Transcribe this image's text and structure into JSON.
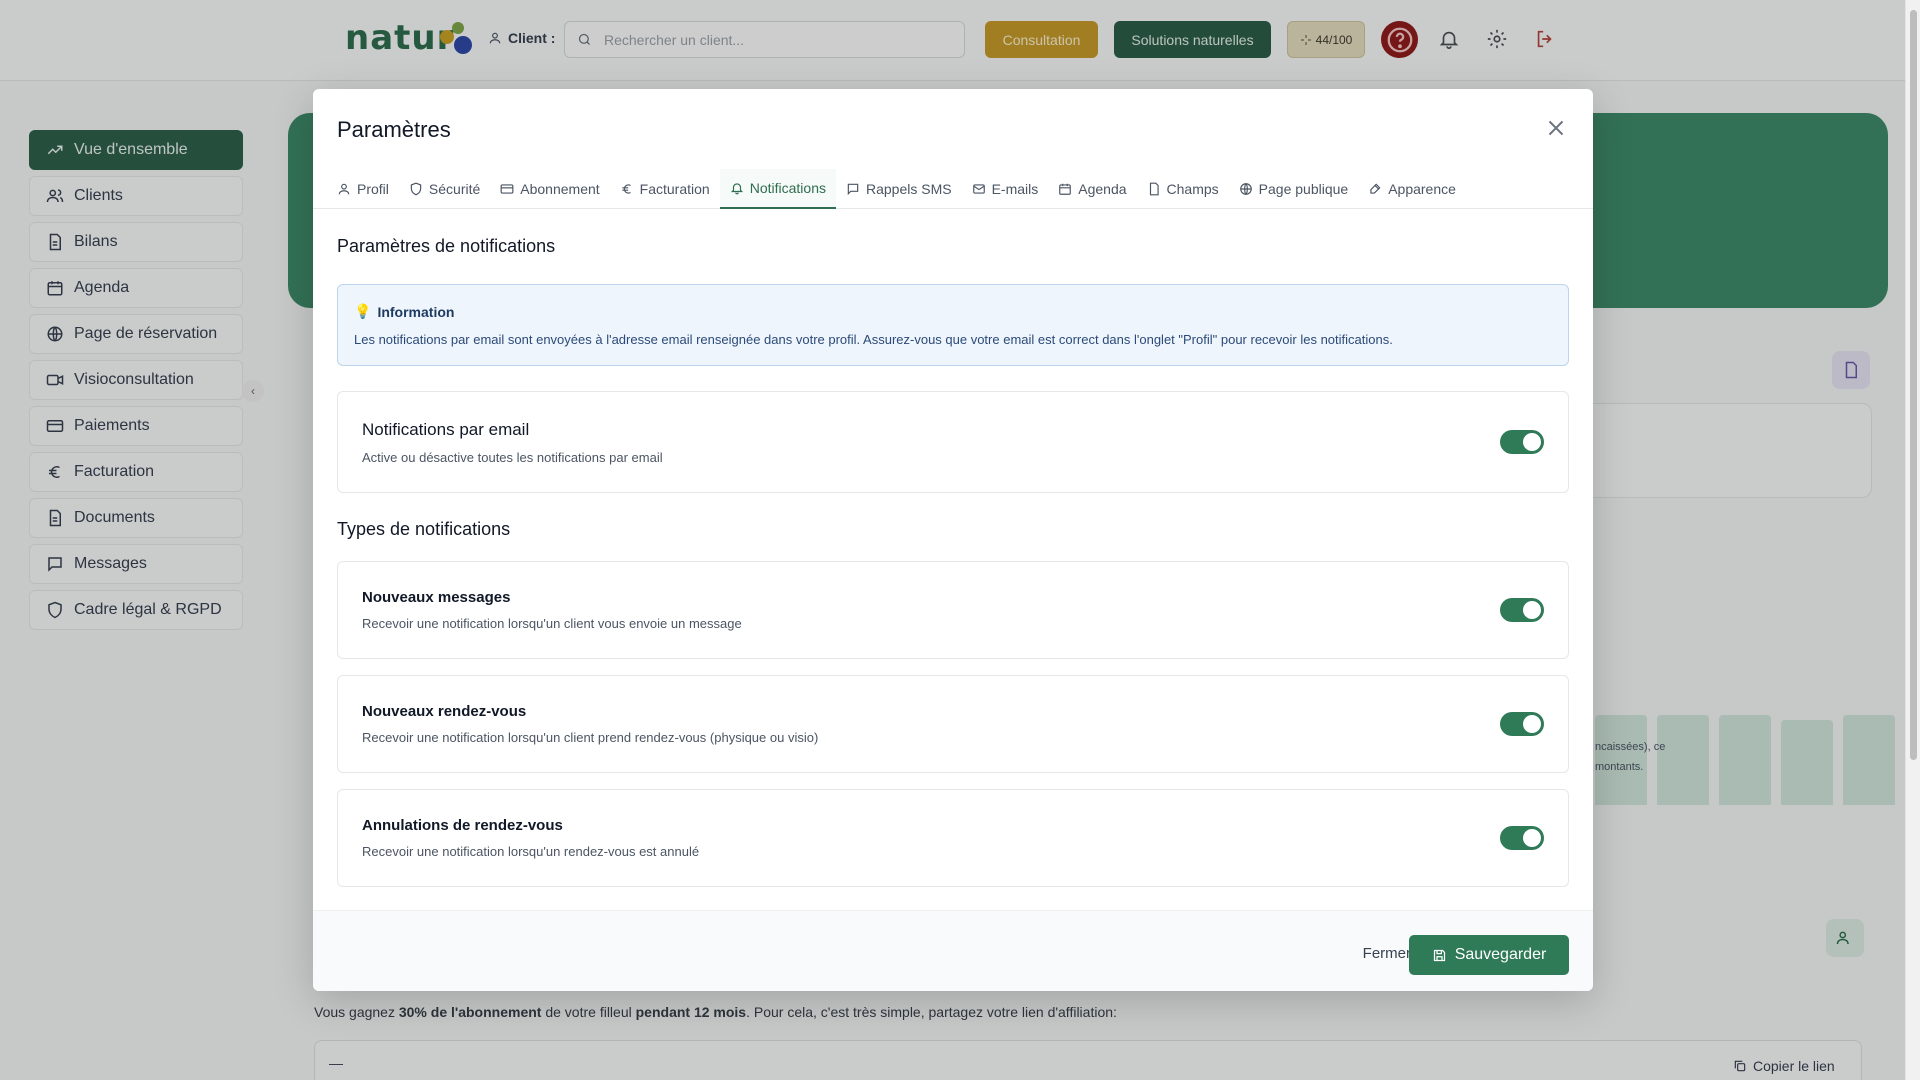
{
  "topbar": {
    "logo_text": "natur",
    "client_label": "Client :",
    "search_placeholder": "Rechercher un client...",
    "consultation_label": "Consultation",
    "solutions_label": "Solutions naturelles",
    "credits": "44/100"
  },
  "sidebar": {
    "items": [
      {
        "label": "Vue d'ensemble",
        "icon": "trend-icon"
      },
      {
        "label": "Clients",
        "icon": "users-icon"
      },
      {
        "label": "Bilans",
        "icon": "file-icon"
      },
      {
        "label": "Agenda",
        "icon": "calendar-icon"
      },
      {
        "label": "Page de réservation",
        "icon": "globe-icon"
      },
      {
        "label": "Visioconsultation",
        "icon": "video-icon"
      },
      {
        "label": "Paiements",
        "icon": "card-icon"
      },
      {
        "label": "Facturation",
        "icon": "euro-icon"
      },
      {
        "label": "Documents",
        "icon": "file-icon"
      },
      {
        "label": "Messages",
        "icon": "message-icon"
      },
      {
        "label": "Cadre légal & RGPD",
        "icon": "shield-icon"
      }
    ]
  },
  "background": {
    "affiliation_pre": "Vous gagnez ",
    "affiliation_pct": "30% de l'abonnement",
    "affiliation_mid": " de votre filleul ",
    "affiliation_dur": "pendant 12 mois",
    "affiliation_post": ". Pour cela, c'est très simple, partagez votre lien d'affiliation:",
    "affiliation_value": "—",
    "copy_link": "Copier le lien",
    "chart_fragment_1": "ncaissées), ce",
    "chart_fragment_2": "montants."
  },
  "modal": {
    "title": "Paramètres",
    "tabs": [
      {
        "label": "Profil",
        "icon": "user-icon"
      },
      {
        "label": "Sécurité",
        "icon": "shield-icon"
      },
      {
        "label": "Abonnement",
        "icon": "card-icon"
      },
      {
        "label": "Facturation",
        "icon": "euro-icon"
      },
      {
        "label": "Notifications",
        "icon": "bell-icon"
      },
      {
        "label": "Rappels SMS",
        "icon": "message-icon"
      },
      {
        "label": "E-mails",
        "icon": "mail-icon"
      },
      {
        "label": "Agenda",
        "icon": "calendar-icon"
      },
      {
        "label": "Champs",
        "icon": "file-icon"
      },
      {
        "label": "Page publique",
        "icon": "globe-icon"
      },
      {
        "label": "Apparence",
        "icon": "brush-icon"
      }
    ],
    "active_tab": "Notifications",
    "section_title": "Paramètres de notifications",
    "info": {
      "heading": "Information",
      "text": "Les notifications par email sont envoyées à l'adresse email renseignée dans votre profil. Assurez-vous que votre email est correct dans l'onglet \"Profil\" pour recevoir les notifications."
    },
    "email_toggle": {
      "title": "Notifications par email",
      "description": "Active ou désactive toutes les notifications par email",
      "enabled": true
    },
    "types_title": "Types de notifications",
    "types": [
      {
        "title": "Nouveaux messages",
        "description": "Recevoir une notification lorsqu'un client vous envoie un message",
        "enabled": true
      },
      {
        "title": "Nouveaux rendez-vous",
        "description": "Recevoir une notification lorsqu'un client prend rendez-vous (physique ou visio)",
        "enabled": true
      },
      {
        "title": "Annulations de rendez-vous",
        "description": "Recevoir une notification lorsqu'un rendez-vous est annulé",
        "enabled": true
      }
    ],
    "footer": {
      "close_label": "Fermer",
      "save_label": "Sauvegarder"
    }
  },
  "colors": {
    "brand_green": "#2f7a57",
    "gold": "#c59a2a",
    "help_red": "#8f1d1d"
  }
}
